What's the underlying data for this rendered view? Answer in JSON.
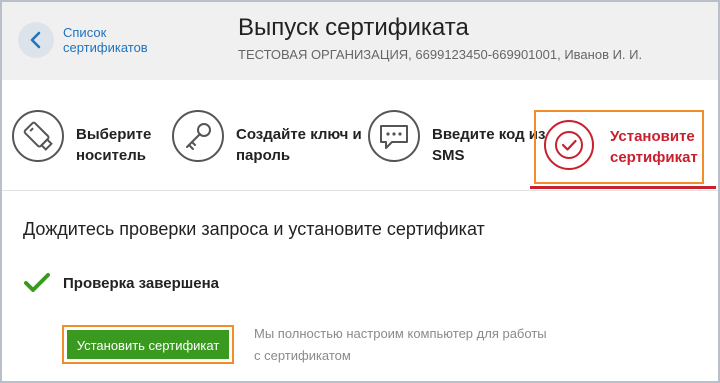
{
  "header": {
    "back_label": "Список сертификатов",
    "title": "Выпуск сертификата",
    "subtitle": "ТЕСТОВАЯ ОРГАНИЗАЦИЯ, 6699123450-669901001, Иванов И. И."
  },
  "steps": [
    {
      "label": "Выберите носитель",
      "icon": "usb-token-icon",
      "state": "done"
    },
    {
      "label": "Создайте ключ и пароль",
      "icon": "key-icon",
      "state": "done"
    },
    {
      "label": "Введите код из SMS",
      "icon": "sms-bubble-icon",
      "state": "done"
    },
    {
      "label": "Установите сертификат",
      "icon": "check-circle-icon",
      "state": "active"
    }
  ],
  "content": {
    "title": "Дождитесь проверки запроса и установите сертификат",
    "check_label": "Проверка завершена",
    "install_button": "Установить сертификат",
    "hint": "Мы полностью настроим компьютер для работы с сертификатом"
  },
  "colors": {
    "accent": "#c9202e",
    "link": "#1e73be",
    "success": "#3a9a20",
    "highlight": "#f28c28"
  }
}
